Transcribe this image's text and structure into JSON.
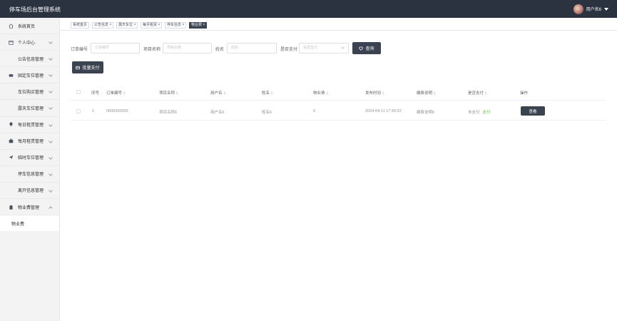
{
  "app": {
    "title": "停车场后台管理系统",
    "username": "用户名6"
  },
  "sidebar": {
    "items": [
      {
        "label": "系统首页",
        "icon": "home-icon",
        "has_chevron": false
      },
      {
        "label": "个人中心",
        "icon": "calendar-icon",
        "has_chevron": true
      },
      {
        "label": "公告信息管理",
        "icon": "grid-icon",
        "has_chevron": true
      },
      {
        "label": "固定车位管理",
        "icon": "car-icon",
        "has_chevron": true
      },
      {
        "label": "车位购买管理",
        "icon": "grid-icon",
        "has_chevron": true
      },
      {
        "label": "露天车位管理",
        "icon": "grid-icon",
        "has_chevron": true
      },
      {
        "label": "每日租赁管理",
        "icon": "location-icon",
        "has_chevron": true
      },
      {
        "label": "每月租赁管理",
        "icon": "briefcase-icon",
        "has_chevron": true
      },
      {
        "label": "临时车位管理",
        "icon": "send-icon",
        "has_chevron": true
      },
      {
        "label": "停车信息管理",
        "icon": "grid-icon",
        "has_chevron": true
      },
      {
        "label": "离开信息管理",
        "icon": "grid-icon",
        "has_chevron": true
      },
      {
        "label": "物业费管理",
        "icon": "clipboard-icon",
        "has_chevron": true,
        "expanded": true
      }
    ],
    "submenu": {
      "label": "物业费"
    }
  },
  "tabs": [
    {
      "label": "系统首页",
      "closable": false
    },
    {
      "label": "公告信息",
      "closable": true
    },
    {
      "label": "露天车位",
      "closable": true
    },
    {
      "label": "每月租赁",
      "closable": true
    },
    {
      "label": "停车信息",
      "closable": true
    },
    {
      "label": "物业费",
      "closable": true,
      "active": true
    }
  ],
  "filters": {
    "order_no": {
      "label": "订单编号",
      "placeholder": "订单编号"
    },
    "project": {
      "label": "项目名称",
      "placeholder": "项目名称"
    },
    "name": {
      "label": "姓名",
      "placeholder": "姓名"
    },
    "paid": {
      "label": "是否支付",
      "placeholder": "是否支付"
    },
    "search_label": "查询",
    "batch_pay_label": "批量支付"
  },
  "table": {
    "columns": [
      "序号",
      "订单编号",
      "项目名称",
      "用户名",
      "姓名",
      "物业费",
      "发布时间",
      "缴费说明",
      "是否支付",
      "操作"
    ],
    "rows": [
      {
        "index": "1",
        "order_no": "0000000000",
        "project": "项目名称6",
        "username": "用户名6",
        "name": "姓名6",
        "fee": "6",
        "time": "2024-04-11 17:49:22",
        "note": "缴费说明6",
        "paid_status": "未支付",
        "pay_link": "支付",
        "view_label": "查看"
      }
    ]
  },
  "colors": {
    "topbar": "#2b3240",
    "accent_dark": "#3c4350",
    "pay_green": "#67c23a"
  }
}
